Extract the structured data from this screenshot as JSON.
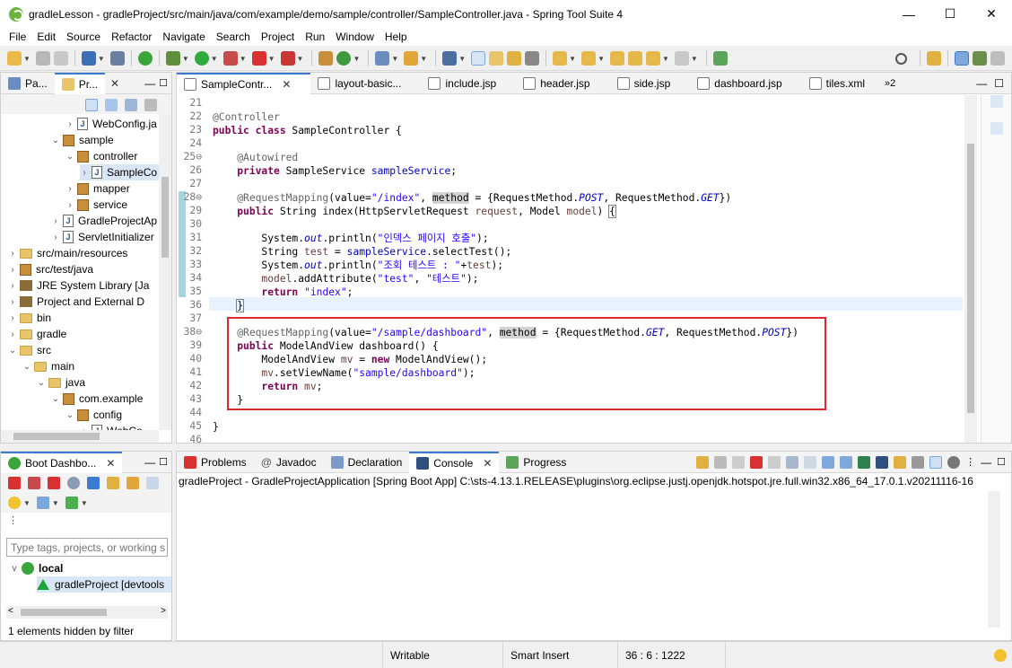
{
  "window": {
    "title": "gradleLesson - gradleProject/src/main/java/com/example/demo/sample/controller/SampleController.java - Spring Tool Suite 4",
    "minimize": "—",
    "maximize": "☐",
    "close": "✕"
  },
  "menu": [
    "File",
    "Edit",
    "Source",
    "Refactor",
    "Navigate",
    "Search",
    "Project",
    "Run",
    "Window",
    "Help"
  ],
  "explorer": {
    "tabs": [
      "Pa...",
      "Pr..."
    ],
    "items": [
      {
        "label": "WebConfig.ja",
        "depth": 5,
        "kind": "java",
        "chev": ">"
      },
      {
        "label": "sample",
        "depth": 4,
        "kind": "pkg",
        "chev": "v"
      },
      {
        "label": "controller",
        "depth": 5,
        "kind": "pkg",
        "chev": "v"
      },
      {
        "label": "SampleCo",
        "depth": 6,
        "kind": "java",
        "chev": ">",
        "selected": true
      },
      {
        "label": "mapper",
        "depth": 5,
        "kind": "pkg",
        "chev": ">"
      },
      {
        "label": "service",
        "depth": 5,
        "kind": "pkg",
        "chev": ">"
      },
      {
        "label": "GradleProjectAp",
        "depth": 4,
        "kind": "java",
        "chev": ">"
      },
      {
        "label": "ServletInitializer",
        "depth": 4,
        "kind": "java",
        "chev": ">"
      },
      {
        "label": "src/main/resources",
        "depth": 1,
        "kind": "folder",
        "chev": ">"
      },
      {
        "label": "src/test/java",
        "depth": 1,
        "kind": "pkg",
        "chev": ">"
      },
      {
        "label": "JRE System Library [Ja",
        "depth": 1,
        "kind": "lib",
        "chev": ">"
      },
      {
        "label": "Project and External D",
        "depth": 1,
        "kind": "lib",
        "chev": ">"
      },
      {
        "label": "bin",
        "depth": 1,
        "kind": "folder",
        "chev": ">"
      },
      {
        "label": "gradle",
        "depth": 1,
        "kind": "folder",
        "chev": ">"
      },
      {
        "label": "src",
        "depth": 1,
        "kind": "folder",
        "chev": "v"
      },
      {
        "label": "main",
        "depth": 2,
        "kind": "folder",
        "chev": "v"
      },
      {
        "label": "java",
        "depth": 3,
        "kind": "folder",
        "chev": "v"
      },
      {
        "label": "com.example",
        "depth": 4,
        "kind": "pkg",
        "chev": "v"
      },
      {
        "label": "config",
        "depth": 5,
        "kind": "pkg",
        "chev": "v"
      },
      {
        "label": "WebCo",
        "depth": 6,
        "kind": "java",
        "chev": ">"
      }
    ]
  },
  "editor": {
    "tabs": [
      {
        "label": "SampleContr...",
        "active": true
      },
      {
        "label": "layout-basic..."
      },
      {
        "label": "include.jsp"
      },
      {
        "label": "header.jsp"
      },
      {
        "label": "side.jsp"
      },
      {
        "label": "dashboard.jsp"
      },
      {
        "label": "tiles.xml"
      }
    ],
    "overflow": "»2",
    "lines": [
      {
        "n": "21",
        "html": ""
      },
      {
        "n": "22",
        "html": "<span class='ann'>@Controller</span>"
      },
      {
        "n": "23",
        "html": "<span class='kw'>public class</span> SampleController {"
      },
      {
        "n": "24",
        "html": ""
      },
      {
        "n": "25⊖",
        "html": "    <span class='ann'>@Autowired</span>"
      },
      {
        "n": "26",
        "html": "    <span class='kw'>private</span> SampleService <span class='fld'>sampleService</span>;"
      },
      {
        "n": "27",
        "html": ""
      },
      {
        "n": "28⊖",
        "html": "    <span class='ann'>@RequestMapping</span>(value=<span class='str'>\"/index\"</span>, <span class='hl'>method</span> = {RequestMethod.<span class='stat'>POST</span>, RequestMethod.<span class='stat'>GET</span>})"
      },
      {
        "n": "29",
        "html": "    <span class='kw'>public</span> String index(HttpServletRequest <span class='var'>request</span>, Model <span class='var'>model</span>) <span style='outline:1px solid #7f7f7f'>{</span>"
      },
      {
        "n": "30",
        "html": ""
      },
      {
        "n": "31",
        "html": "        System.<span class='stat'>out</span>.println(<span class='str'>\"인덱스 페이지 호출\"</span>);"
      },
      {
        "n": "32",
        "html": "        String <span class='var'>test</span> = <span class='fld'>sampleService</span>.selectTest();"
      },
      {
        "n": "33",
        "html": "        System.<span class='stat'>out</span>.println(<span class='str'>\"조회 테스트 : \"</span>+<span class='var'>test</span>);"
      },
      {
        "n": "34",
        "html": "        <span class='var'>model</span>.addAttribute(<span class='str'>\"test\"</span>, <span class='str'>\"테스트\"</span>);"
      },
      {
        "n": "35",
        "html": "        <span class='kw'>return</span> <span class='str'>\"index\"</span>;"
      },
      {
        "n": "36",
        "html": "    <span style='outline:1px solid #7f7f7f'>}</span>"
      },
      {
        "n": "37",
        "html": ""
      },
      {
        "n": "38⊖",
        "html": "    <span class='ann'>@RequestMapping</span>(value=<span class='str'>\"/sample/dashboard\"</span>, <span class='hl'>method</span> = {RequestMethod.<span class='stat'>GET</span>, RequestMethod.<span class='stat'>POST</span>})"
      },
      {
        "n": "39",
        "html": "    <span class='kw'>public</span> ModelAndView dashboard() {"
      },
      {
        "n": "40",
        "html": "        ModelAndView <span class='var'>mv</span> = <span class='kw'>new</span> ModelAndView();"
      },
      {
        "n": "41",
        "html": "        <span class='var'>mv</span>.setViewName(<span class='str'>\"sample/dashboard\"</span>);"
      },
      {
        "n": "42",
        "html": "        <span class='kw'>return</span> <span class='var'>mv</span>;"
      },
      {
        "n": "43",
        "html": "    }"
      },
      {
        "n": "44",
        "html": ""
      },
      {
        "n": "45",
        "html": "}"
      },
      {
        "n": "46",
        "html": ""
      }
    ]
  },
  "boot_dashboard": {
    "tab": "Boot Dashbo...",
    "filter_placeholder": "Type tags, projects, or working s",
    "local_label": "local",
    "project_label": "gradleProject [devtools",
    "hidden_info": "1 elements hidden by filter"
  },
  "console": {
    "tabs": [
      "Problems",
      "Javadoc",
      "Declaration",
      "Console",
      "Progress"
    ],
    "header": "gradleProject - GradleProjectApplication [Spring Boot App] C:\\sts-4.13.1.RELEASE\\plugins\\org.eclipse.justj.openjdk.hotspot.jre.full.win32.x86_64_17.0.1.v20211116-16"
  },
  "status": {
    "writable": "Writable",
    "insert_mode": "Smart Insert",
    "position": "36 : 6 : 1222"
  }
}
